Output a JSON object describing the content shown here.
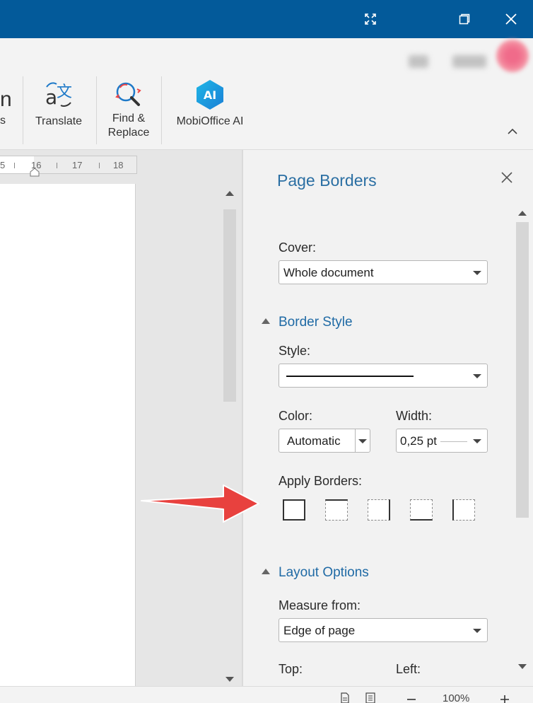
{
  "window": {
    "controls": [
      "restore-fullscreen",
      "maximize",
      "close"
    ]
  },
  "ribbon": {
    "cut_label": "s",
    "translate": {
      "label": "Translate",
      "icon": "translate-icon"
    },
    "find_replace": {
      "label_line1": "Find &",
      "label_line2": "Replace",
      "icon": "find-replace-icon"
    },
    "mobioffice_ai": {
      "label": "MobiOffice AI",
      "icon_text": "AI"
    }
  },
  "ruler": {
    "ticks": [
      "5",
      "16",
      "17",
      "18"
    ]
  },
  "panel": {
    "title": "Page Borders",
    "cover": {
      "label": "Cover:",
      "value": "Whole document"
    },
    "border_style": {
      "heading": "Border Style",
      "style_label": "Style:",
      "color_label": "Color:",
      "color_value": "Automatic",
      "width_label": "Width:",
      "width_value": "0,25 pt",
      "apply_label": "Apply Borders:"
    },
    "layout_options": {
      "heading": "Layout Options",
      "measure_label": "Measure from:",
      "measure_value": "Edge of page",
      "top_label": "Top:",
      "left_label": "Left:"
    }
  },
  "status": {
    "zoom": "100%"
  },
  "colors": {
    "titlebar": "#035a9a",
    "accent": "#1f6aa5",
    "annotation_arrow": "#e8413e"
  }
}
